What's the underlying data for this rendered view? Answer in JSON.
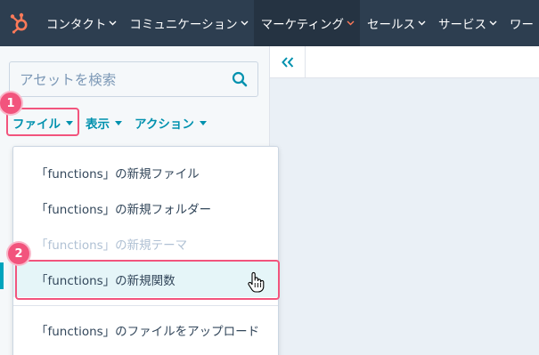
{
  "nav": {
    "items": [
      {
        "label": "コンタクト",
        "active": false
      },
      {
        "label": "コミュニケーション",
        "active": false
      },
      {
        "label": "マーケティング",
        "active": true
      },
      {
        "label": "セールス",
        "active": false
      },
      {
        "label": "サービス",
        "active": false
      },
      {
        "label": "ワー",
        "active": false
      }
    ],
    "brand_color": "#ff7a59",
    "bg_color": "#2d3e50"
  },
  "search": {
    "placeholder": "アセットを検索"
  },
  "menu": {
    "file": "ファイル",
    "view": "表示",
    "actions": "アクション"
  },
  "dropdown": {
    "items": [
      {
        "label": "「functions」の新規ファイル",
        "state": "normal"
      },
      {
        "label": "「functions」の新規フォルダー",
        "state": "normal"
      },
      {
        "label": "「functions」の新規テーマ",
        "state": "disabled"
      },
      {
        "label": "「functions」の新規関数",
        "state": "hover"
      },
      {
        "label": "「functions」のファイルをアップロード",
        "state": "normal"
      }
    ]
  },
  "annotations": {
    "step1": "1",
    "step2": "2",
    "color": "#f2547d"
  },
  "icons": {
    "logo": "hubspot-sprocket-icon",
    "search": "search-icon",
    "collapse": "double-chevron-left-icon",
    "cursor": "hand-pointer-icon"
  }
}
